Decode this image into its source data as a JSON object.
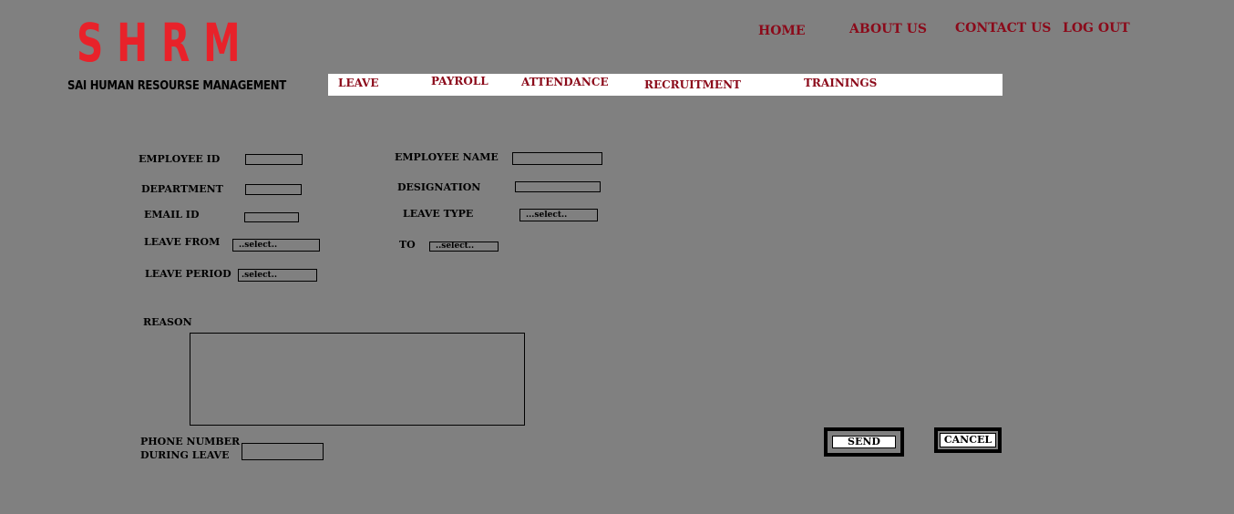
{
  "brand": {
    "logo": "SHRM",
    "tagline": "SAI HUMAN RESOURSE MANAGEMENT"
  },
  "top_nav": {
    "home": "HOME",
    "about": "ABOUT US",
    "contact": "CONTACT US",
    "logout": "LOG OUT"
  },
  "modules": {
    "leave": "LEAVE",
    "payroll": "PAYROLL",
    "attendance": "ATTENDANCE",
    "recruitment": "RECRUITMENT",
    "trainings": "TRAININGS"
  },
  "form": {
    "employee_id_label": "EMPLOYEE ID",
    "employee_name_label": "EMPLOYEE NAME",
    "department_label": "DEPARTMENT",
    "designation_label": "DESIGNATION",
    "email_label": "EMAIL ID",
    "leave_type_label": "LEAVE TYPE",
    "leave_type_value": "...select..",
    "leave_from_label": "LEAVE FROM",
    "leave_from_value": "..select..",
    "to_label": "TO",
    "to_value": "..select..",
    "leave_period_label": "LEAVE PERIOD",
    "leave_period_value": ".select..",
    "reason_label": "REASON",
    "phone_label_line1": "PHONE NUMBER",
    "phone_label_line2": "DURING LEAVE"
  },
  "actions": {
    "send": "SEND",
    "cancel": "CANCEL"
  },
  "colors": {
    "background": "#808080",
    "logo_red": "#e8222a",
    "nav_maroon": "#8b0a1a",
    "module_bar": "#ffffff"
  }
}
